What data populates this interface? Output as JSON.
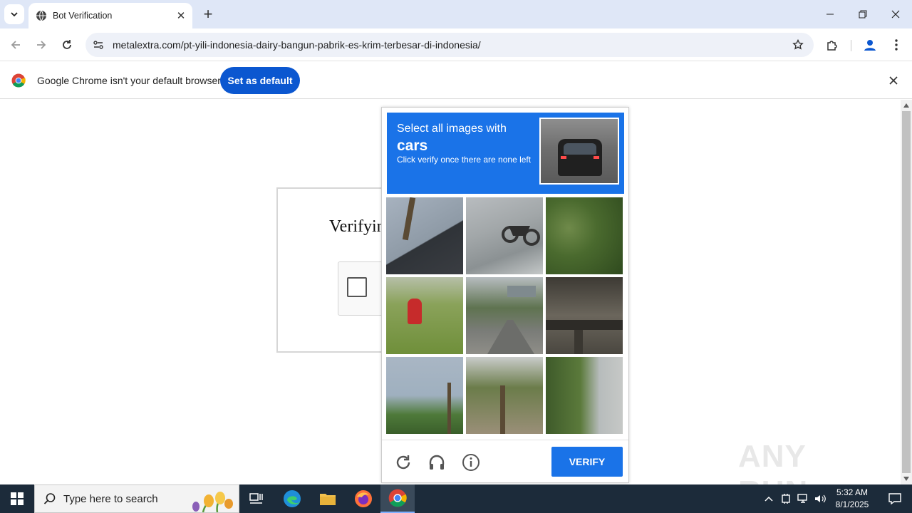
{
  "browser": {
    "tab_title": "Bot Verification",
    "url": "metalextra.com/pt-yili-indonesia-dairy-bangun-pabrik-es-krim-terbesar-di-indonesia/",
    "infobar_text": "Google Chrome isn't your default browser",
    "set_default_label": "Set as default"
  },
  "page": {
    "verify_title": "Verifyin"
  },
  "captcha": {
    "line1": "Select all images with",
    "target": "cars",
    "line3": "Click verify once there are none left",
    "verify_label": "VERIFY",
    "tiles": [
      "palm-roof",
      "motorcycle-sidewalk",
      "palm-trees",
      "fire-hydrant",
      "highway-sign",
      "bridge-underside",
      "palm-sky",
      "palm-fronds",
      "cypress-trees"
    ]
  },
  "watermark": "ANY RUN",
  "taskbar": {
    "search_placeholder": "Type here to search",
    "time": "5:32 AM",
    "date": "8/1/2025"
  },
  "colors": {
    "captcha_blue": "#1a73e8",
    "chrome_button_blue": "#0b57d0",
    "tabstrip": "#dfe7f7",
    "taskbar": "#1c2b3a"
  }
}
